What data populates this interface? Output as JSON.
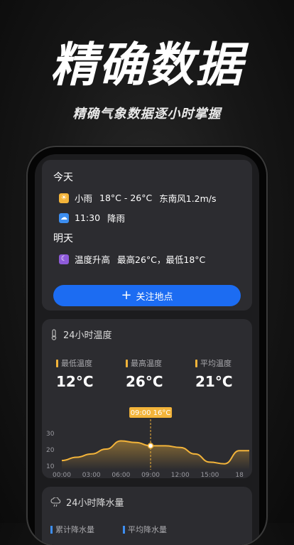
{
  "promo": {
    "title": "精确数据",
    "subtitle": "精确气象数据逐小时掌握"
  },
  "today": {
    "label": "今天",
    "weather": "小雨",
    "temp_range": "18°C - 26°C",
    "wind": "东南风1.2m/s",
    "rain_time": "11:30",
    "rain_text": "降雨"
  },
  "tomorrow": {
    "label": "明天",
    "summary": "温度升高",
    "detail": "最高26°C，最低18°C"
  },
  "follow_button": {
    "label": "关注地点"
  },
  "temp_card": {
    "title": "24小时温度",
    "stats": [
      {
        "label": "最低温度",
        "value": "12°C"
      },
      {
        "label": "最高温度",
        "value": "26°C"
      },
      {
        "label": "平均温度",
        "value": "21°C"
      }
    ]
  },
  "chart_data": {
    "type": "area",
    "title": "24小时温度",
    "y_ticks": [
      "30",
      "20",
      "10"
    ],
    "ylim": [
      10,
      30
    ],
    "x_ticks": [
      "00:00",
      "03:00",
      "06:00",
      "09:00",
      "12:00",
      "15:00",
      "18"
    ],
    "series": [
      {
        "x": [
          0,
          1.5,
          3,
          4.5,
          6,
          7.5,
          9,
          10.5,
          12,
          13.5,
          15,
          16.5,
          18,
          19
        ],
        "values": [
          13,
          15,
          17,
          20,
          25,
          24,
          22,
          22,
          21,
          17,
          12,
          11,
          19,
          19
        ]
      }
    ],
    "tooltip": {
      "time": "09:00",
      "value": "16°C"
    },
    "accent_color": "#f3b43a"
  },
  "rain_card": {
    "title": "24小时降水量",
    "stats": [
      {
        "label": "累计降水量"
      },
      {
        "label": "平均降水量"
      }
    ]
  },
  "colors": {
    "accent": "#1c6cf2",
    "temp_line": "#f3b43a",
    "card": "#2c2c30"
  }
}
